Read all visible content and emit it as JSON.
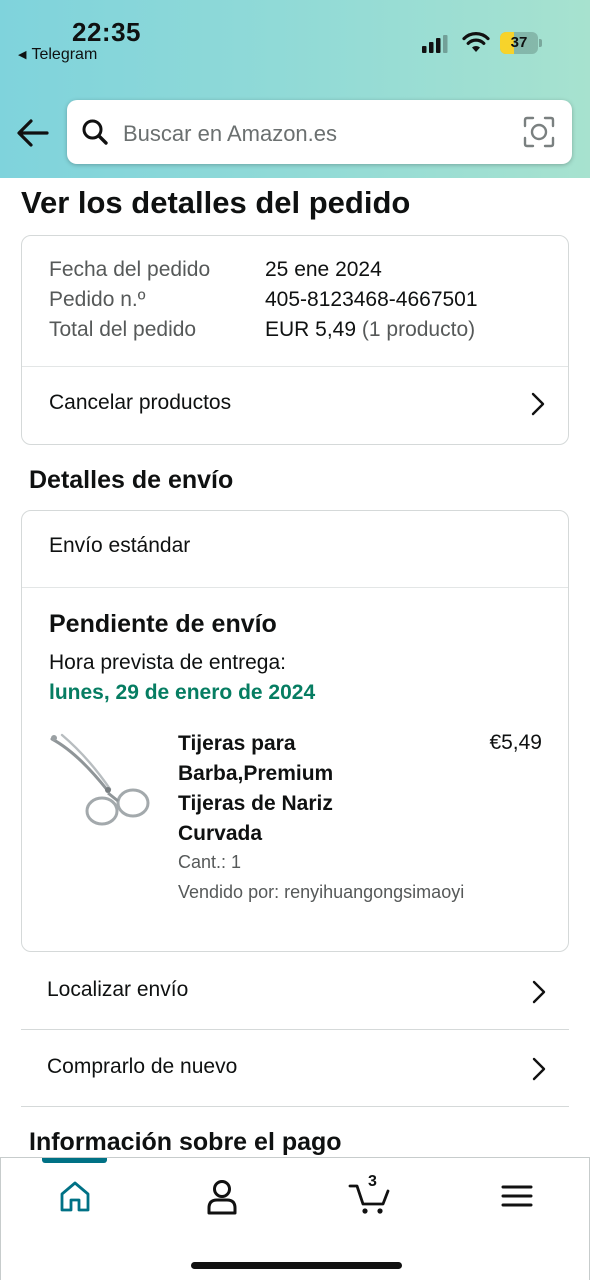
{
  "status_bar": {
    "time": "22:35",
    "back_app": "Telegram",
    "battery_level": "37",
    "battery_fraction": 0.37
  },
  "search": {
    "placeholder": "Buscar en Amazon.es"
  },
  "page_title": "Ver los detalles del pedido",
  "order_summary": {
    "date_label": "Fecha del pedido",
    "date_value": "25 ene 2024",
    "number_label": "Pedido n.º",
    "number_value": "405-8123468-4667501",
    "total_label": "Total del pedido",
    "total_value": "EUR 5,49",
    "total_count": "(1 producto)",
    "cancel_label": "Cancelar productos"
  },
  "shipping": {
    "section_title": "Detalles de envío",
    "method": "Envío estándar",
    "status": "Pendiente de envío",
    "eta_label": "Hora prevista de entrega:",
    "eta_date": "lunes, 29 de enero de 2024",
    "product": {
      "title_lines": [
        "Tijeras para",
        "Barba,Premium",
        "Tijeras de Nariz",
        "Curvada"
      ],
      "price": "€5,49",
      "quantity": "Cant.: 1",
      "seller": "Vendido por: renyihuangongsimaoyi"
    }
  },
  "actions": {
    "track": "Localizar envío",
    "buy_again": "Comprarlo de nuevo"
  },
  "payment_title": "Información sobre el pago",
  "tab_bar": {
    "cart_count": "3",
    "tabs": [
      {
        "icon": "home-icon",
        "active": true
      },
      {
        "icon": "user-icon",
        "active": false
      },
      {
        "icon": "cart-icon",
        "active": false
      },
      {
        "icon": "menu-icon",
        "active": false
      }
    ]
  },
  "colors": {
    "accent": "#007185",
    "delivery_green": "#067d62",
    "battery_yellow": "#f7d32b"
  }
}
